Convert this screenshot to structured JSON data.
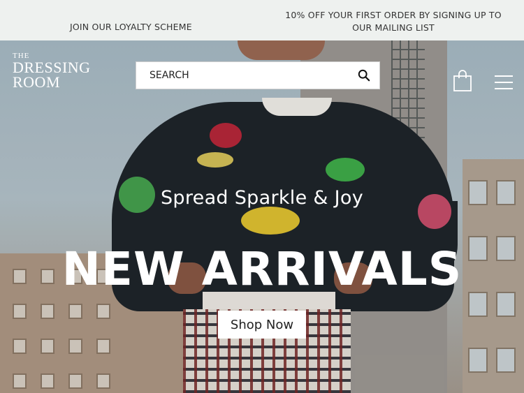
{
  "promo": {
    "loyalty": "JOIN OUR LOYALTY SCHEME",
    "discount": "10% OFF YOUR FIRST ORDER BY SIGNING UP TO OUR MAILING LIST"
  },
  "header": {
    "logo": {
      "line1": "THE",
      "line2": "DRESSING",
      "line3": "ROOM"
    },
    "search": {
      "placeholder": "SEARCH"
    },
    "icons": {
      "search": "search-icon",
      "bag": "shopping-bag-icon",
      "menu": "hamburger-menu-icon"
    }
  },
  "hero": {
    "tagline": "Spread Sparkle & Joy",
    "headline": "NEW ARRIVALS",
    "cta": "Shop Now"
  },
  "colors": {
    "promo_bg": "#eef1ef",
    "text_on_image": "#ffffff",
    "button_bg": "#ffffff"
  }
}
